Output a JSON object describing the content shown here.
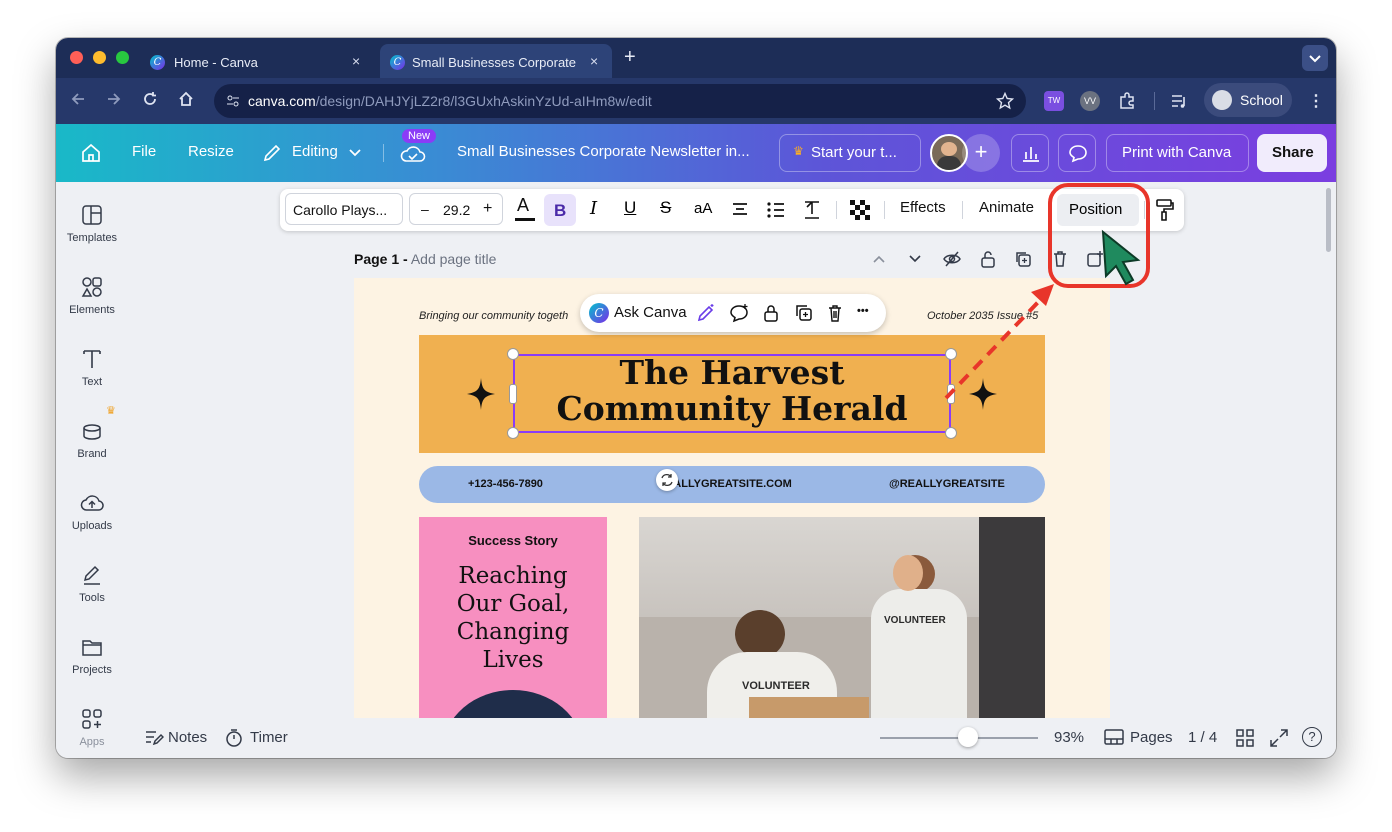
{
  "browser": {
    "tabs": [
      {
        "label": "Home - Canva",
        "close": "×"
      },
      {
        "label": "Small Businesses Corporate Newsletter in",
        "close": "×"
      }
    ],
    "new_tab": "+",
    "url_domain": "canva.com",
    "url_path": "/design/DAHJYjLZ2r8/l3GUxhAskinYzUd-aIHm8w/edit",
    "profile_label": "School",
    "extension_tw": "TW"
  },
  "header": {
    "file": "File",
    "resize": "Resize",
    "editing": "Editing",
    "new_badge": "New",
    "doc_title": "Small Businesses Corporate Newsletter in...",
    "trial": "Start your t...",
    "print": "Print with Canva",
    "share": "Share"
  },
  "sidebar": {
    "items": [
      {
        "label": "Templates",
        "icon": "templates-icon"
      },
      {
        "label": "Elements",
        "icon": "elements-icon"
      },
      {
        "label": "Text",
        "icon": "text-icon"
      },
      {
        "label": "Brand",
        "icon": "brand-icon"
      },
      {
        "label": "Uploads",
        "icon": "uploads-icon"
      },
      {
        "label": "Tools",
        "icon": "tools-icon"
      },
      {
        "label": "Projects",
        "icon": "projects-icon"
      },
      {
        "label": "Apps",
        "icon": "apps-icon"
      }
    ]
  },
  "toolbar": {
    "font": "Carollo Plays...",
    "minus": "–",
    "size": "29.2",
    "plus": "+",
    "case": "aA",
    "effects": "Effects",
    "animate": "Animate",
    "position": "Position"
  },
  "page_header": {
    "page_label": "Page 1 -",
    "title_placeholder": "Add page title"
  },
  "floating_menu": {
    "ask_canva": "Ask Canva",
    "more": "•••"
  },
  "newsletter": {
    "tagline": "Bringing our community togeth",
    "issue": "October 2035 Issue #5",
    "title_line1": "The Harvest",
    "title_line2": "Community Herald",
    "phone": "+123-456-7890",
    "website": "REALLYGREATSITE.COM",
    "social": "@REALLYGREATSITE",
    "story_kicker": "Success Story",
    "story_line1": "Reaching",
    "story_line2": "Our Goal,",
    "story_line3": "Changing",
    "story_line4": "Lives",
    "photo_shirt1": "VOLUNTEER",
    "photo_shirt2": "VOLUNTEER"
  },
  "footer": {
    "notes": "Notes",
    "timer": "Timer",
    "zoom": "93%",
    "pages": "Pages",
    "page_count": "1 / 4",
    "help": "?"
  },
  "colors": {
    "tab_strip": "#1d2d57",
    "banner": "#f0b050",
    "contact_bar": "#9bb8e6",
    "story_box": "#f78fc0",
    "callout": "#e8352a",
    "cursor": "#1f8a5e",
    "selection": "#7d2ae8"
  }
}
